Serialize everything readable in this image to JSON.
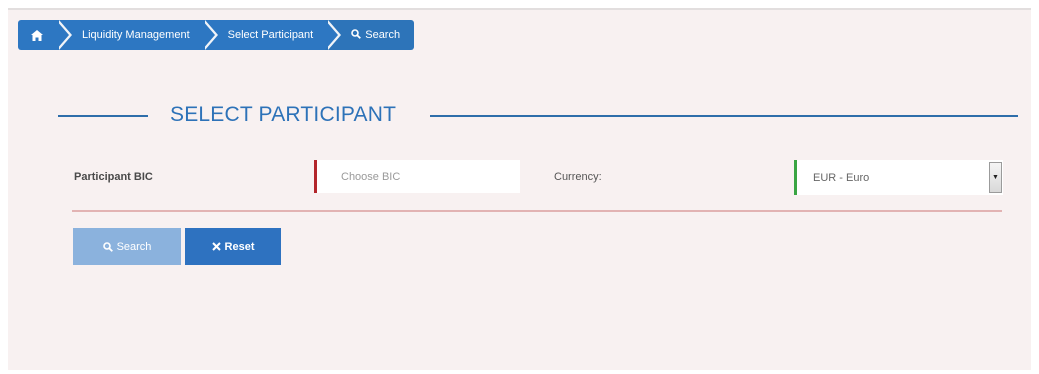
{
  "breadcrumb": {
    "home_icon": "home-icon",
    "items": [
      {
        "label": "Liquidity Management"
      },
      {
        "label": "Select Participant"
      },
      {
        "label": "Search",
        "icon": "search-icon"
      }
    ]
  },
  "section": {
    "title": "SELECT PARTICIPANT"
  },
  "form": {
    "participant_bic": {
      "label": "Participant BIC",
      "value": "",
      "placeholder": "Choose BIC",
      "status_color": "#b3262b"
    },
    "currency": {
      "label": "Currency:",
      "selected": "EUR - Euro",
      "status_color": "#3aa543"
    }
  },
  "actions": {
    "search": {
      "label": "Search",
      "icon": "search-icon",
      "enabled": false
    },
    "reset": {
      "label": "Reset",
      "icon": "close-icon"
    }
  },
  "colors": {
    "primary": "#2d77c2",
    "primary_disabled": "#8bb2dd",
    "background": "#f8f1f1"
  }
}
